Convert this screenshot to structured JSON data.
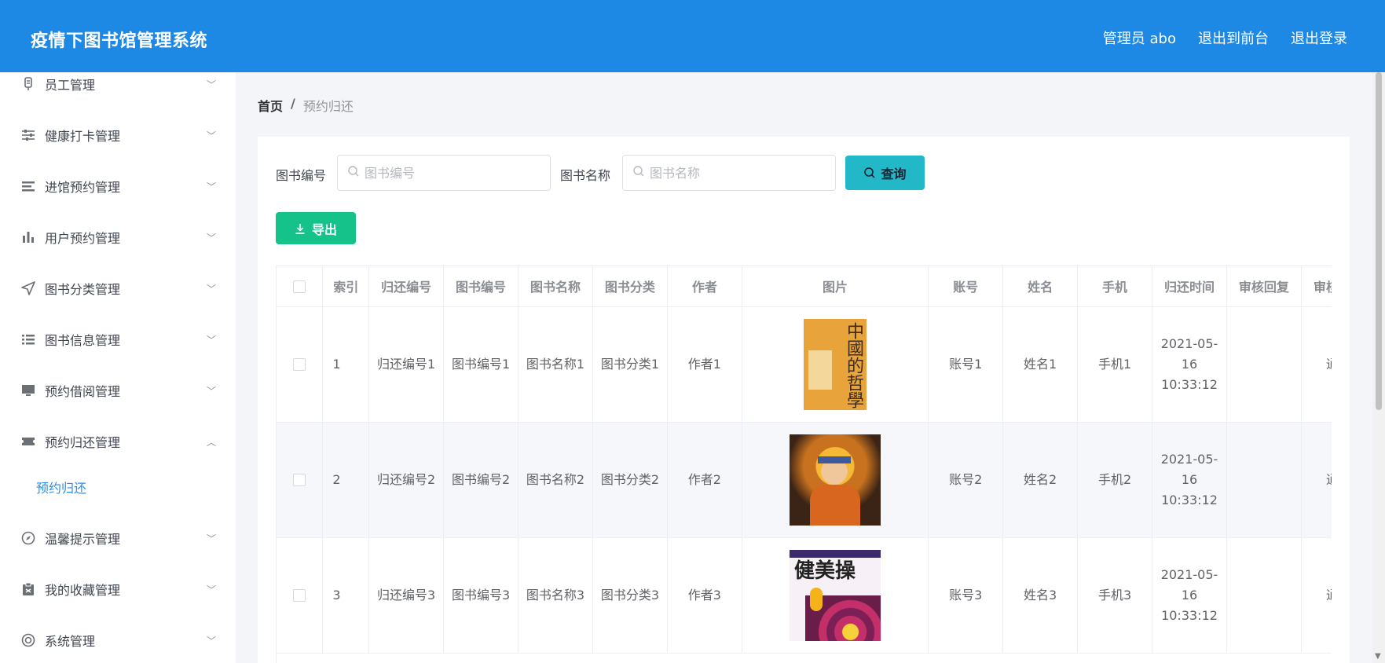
{
  "header": {
    "title": "疫情下图书馆管理系统",
    "user": "管理员 abo",
    "to_front": "退出到前台",
    "logout": "退出登录"
  },
  "sidebar": {
    "items": [
      {
        "label": "员工管理",
        "icon": "employee-icon",
        "expanded": false
      },
      {
        "label": "健康打卡管理",
        "icon": "sliders-icon",
        "expanded": false
      },
      {
        "label": "进馆预约管理",
        "icon": "list-icon",
        "expanded": false
      },
      {
        "label": "用户预约管理",
        "icon": "bar-chart-icon",
        "expanded": false
      },
      {
        "label": "图书分类管理",
        "icon": "send-icon",
        "expanded": false
      },
      {
        "label": "图书信息管理",
        "icon": "list-detail-icon",
        "expanded": false
      },
      {
        "label": "预约借阅管理",
        "icon": "monitor-icon",
        "expanded": false
      },
      {
        "label": "预约归还管理",
        "icon": "ticket-icon",
        "expanded": true
      },
      {
        "label": "温馨提示管理",
        "icon": "compass-icon",
        "expanded": false
      },
      {
        "label": "我的收藏管理",
        "icon": "clipboard-icon",
        "expanded": false
      },
      {
        "label": "系统管理",
        "icon": "lifebuoy-icon",
        "expanded": false
      }
    ],
    "subitem": "预约归还"
  },
  "breadcrumb": {
    "home": "首页",
    "sep": "/",
    "current": "预约归还"
  },
  "filters": {
    "book_no_label": "图书编号",
    "book_no_placeholder": "图书编号",
    "book_name_label": "图书名称",
    "book_name_placeholder": "图书名称",
    "query_label": "查询",
    "export_label": "导出"
  },
  "table": {
    "headers": [
      "索引",
      "归还编号",
      "图书编号",
      "图书名称",
      "图书分类",
      "作者",
      "图片",
      "账号",
      "姓名",
      "手机",
      "归还时间",
      "审核回复",
      "审核状态"
    ],
    "rows": [
      {
        "index": "1",
        "return_no": "归还编号1",
        "book_no": "图书编号1",
        "book_name": "图书名称1",
        "category": "图书分类1",
        "author": "作者1",
        "cover_title": "中國的哲學",
        "account": "账号1",
        "name": "姓名1",
        "phone": "手机1",
        "return_time": "2021-05-16 10:33:12",
        "reply": "",
        "status": "通过"
      },
      {
        "index": "2",
        "return_no": "归还编号2",
        "book_no": "图书编号2",
        "book_name": "图书名称2",
        "category": "图书分类2",
        "author": "作者2",
        "cover_title": "",
        "account": "账号2",
        "name": "姓名2",
        "phone": "手机2",
        "return_time": "2021-05-16 10:33:12",
        "reply": "",
        "status": "通过"
      },
      {
        "index": "3",
        "return_no": "归还编号3",
        "book_no": "图书编号3",
        "book_name": "图书名称3",
        "category": "图书分类3",
        "author": "作者3",
        "cover_title": "健美操",
        "account": "账号3",
        "name": "姓名3",
        "phone": "手机3",
        "return_time": "2021-05-16 10:33:12",
        "reply": "",
        "status": "通过"
      }
    ]
  },
  "colors": {
    "header_bg": "#1e88e5",
    "active_link": "#2a8ef0",
    "query_button": "#22b8c8",
    "export_button": "#14c28a"
  }
}
